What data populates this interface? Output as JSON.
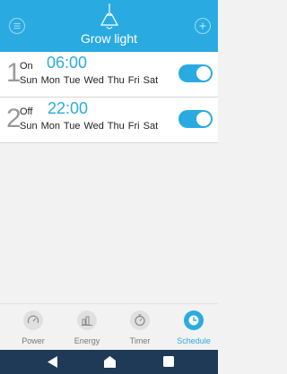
{
  "header": {
    "title": "Grow light",
    "menu_icon": "menu-icon",
    "add_icon": "plus-icon",
    "lamp_icon": "hanging-lamp-icon",
    "accent": "#29abe2"
  },
  "schedules": [
    {
      "index": "1",
      "state": "On",
      "time": "06:00",
      "days": "Sun Mon Tue Wed Thu Fri Sat",
      "enabled": true
    },
    {
      "index": "2",
      "state": "Off",
      "time": "22:00",
      "days": "Sun Mon Tue Wed Thu Fri Sat",
      "enabled": true
    }
  ],
  "tabs": [
    {
      "label": "Power",
      "icon": "power-gauge-icon",
      "active": false
    },
    {
      "label": "Energy",
      "icon": "bar-chart-icon",
      "active": false
    },
    {
      "label": "Timer",
      "icon": "timer-icon",
      "active": false
    },
    {
      "label": "Schedule",
      "icon": "clock-icon",
      "active": true
    }
  ],
  "system_nav": {
    "back_icon": "back-triangle-icon",
    "home_icon": "home-icon",
    "recents_icon": "recents-square-icon"
  }
}
